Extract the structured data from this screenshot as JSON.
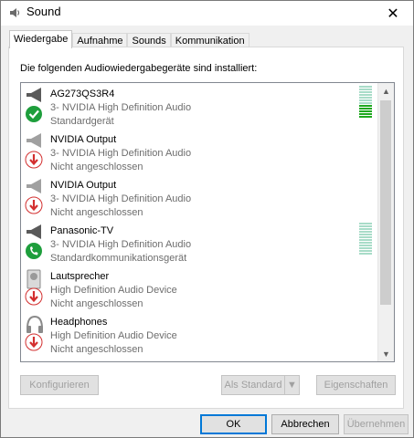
{
  "window": {
    "title": "Sound"
  },
  "tabs": [
    {
      "label": "Wiedergabe"
    },
    {
      "label": "Aufnahme"
    },
    {
      "label": "Sounds"
    },
    {
      "label": "Kommunikation"
    }
  ],
  "intro": "Die folgenden Audiowiedergabegeräte sind installiert:",
  "devices": [
    {
      "name": "AG273QS3R4",
      "line2": "3- NVIDIA High Definition Audio",
      "line3": "Standardgerät",
      "icon": "monitor-speaker-icon",
      "badge": "check-badge-icon",
      "meter": 0.4
    },
    {
      "name": "NVIDIA Output",
      "line2": "3- NVIDIA High Definition Audio",
      "line3": "Nicht angeschlossen",
      "icon": "monitor-speaker-icon",
      "badge": "down-arrow-badge-icon"
    },
    {
      "name": "NVIDIA Output",
      "line2": "3- NVIDIA High Definition Audio",
      "line3": "Nicht angeschlossen",
      "icon": "monitor-speaker-icon",
      "badge": "down-arrow-badge-icon"
    },
    {
      "name": "Panasonic-TV",
      "line2": "3- NVIDIA High Definition Audio",
      "line3": "Standardkommunikationsgerät",
      "icon": "monitor-speaker-icon",
      "badge": "phone-badge-icon",
      "meter": 0
    },
    {
      "name": "Lautsprecher",
      "line2": "High Definition Audio Device",
      "line3": "Nicht angeschlossen",
      "icon": "speaker-icon",
      "badge": "down-arrow-badge-icon"
    },
    {
      "name": "Headphones",
      "line2": "High Definition Audio Device",
      "line3": "Nicht angeschlossen",
      "icon": "headphones-icon",
      "badge": "down-arrow-badge-icon"
    }
  ],
  "buttons": {
    "configure": "Konfigurieren",
    "set_default": "Als Standard",
    "properties": "Eigenschaften",
    "ok": "OK",
    "cancel": "Abbrechen",
    "apply": "Übernehmen"
  },
  "colors": {
    "accent": "#0078d7",
    "meter_on": "#1fa81f",
    "meter_off": "#a8dcc8"
  }
}
